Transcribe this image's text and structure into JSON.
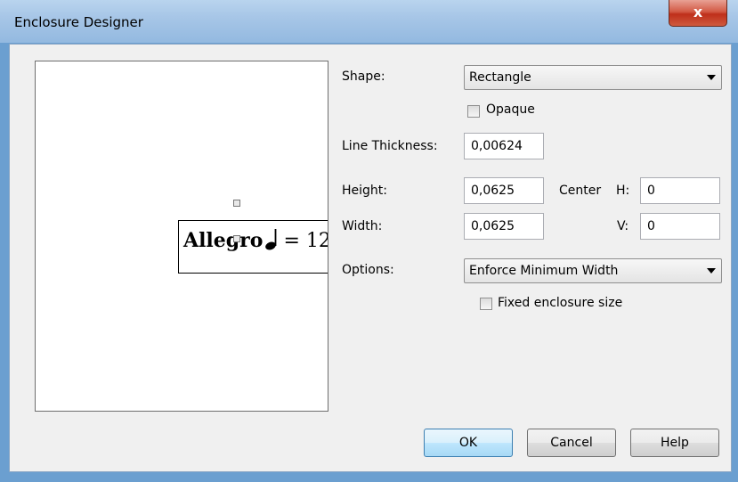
{
  "window": {
    "title": "Enclosure Designer",
    "close_glyph": "x"
  },
  "preview": {
    "tempo_word": "Allegro",
    "tempo_equals": "= 12"
  },
  "form": {
    "shape": {
      "label": "Shape:",
      "value": "Rectangle"
    },
    "opaque": {
      "label": "Opaque",
      "checked": false
    },
    "line_thickness": {
      "label": "Line Thickness:",
      "value": "0,00624"
    },
    "height": {
      "label": "Height:",
      "value": "0,0625"
    },
    "width": {
      "label": "Width:",
      "value": "0,0625"
    },
    "center_label": "Center",
    "center_h": {
      "label": "H:",
      "value": "0"
    },
    "center_v": {
      "label": "V:",
      "value": "0"
    },
    "options": {
      "label": "Options:",
      "value": "Enforce Minimum Width"
    },
    "fixed_size": {
      "label": "Fixed enclosure size",
      "checked": false
    }
  },
  "buttons": {
    "ok": "OK",
    "cancel": "Cancel",
    "help": "Help"
  }
}
